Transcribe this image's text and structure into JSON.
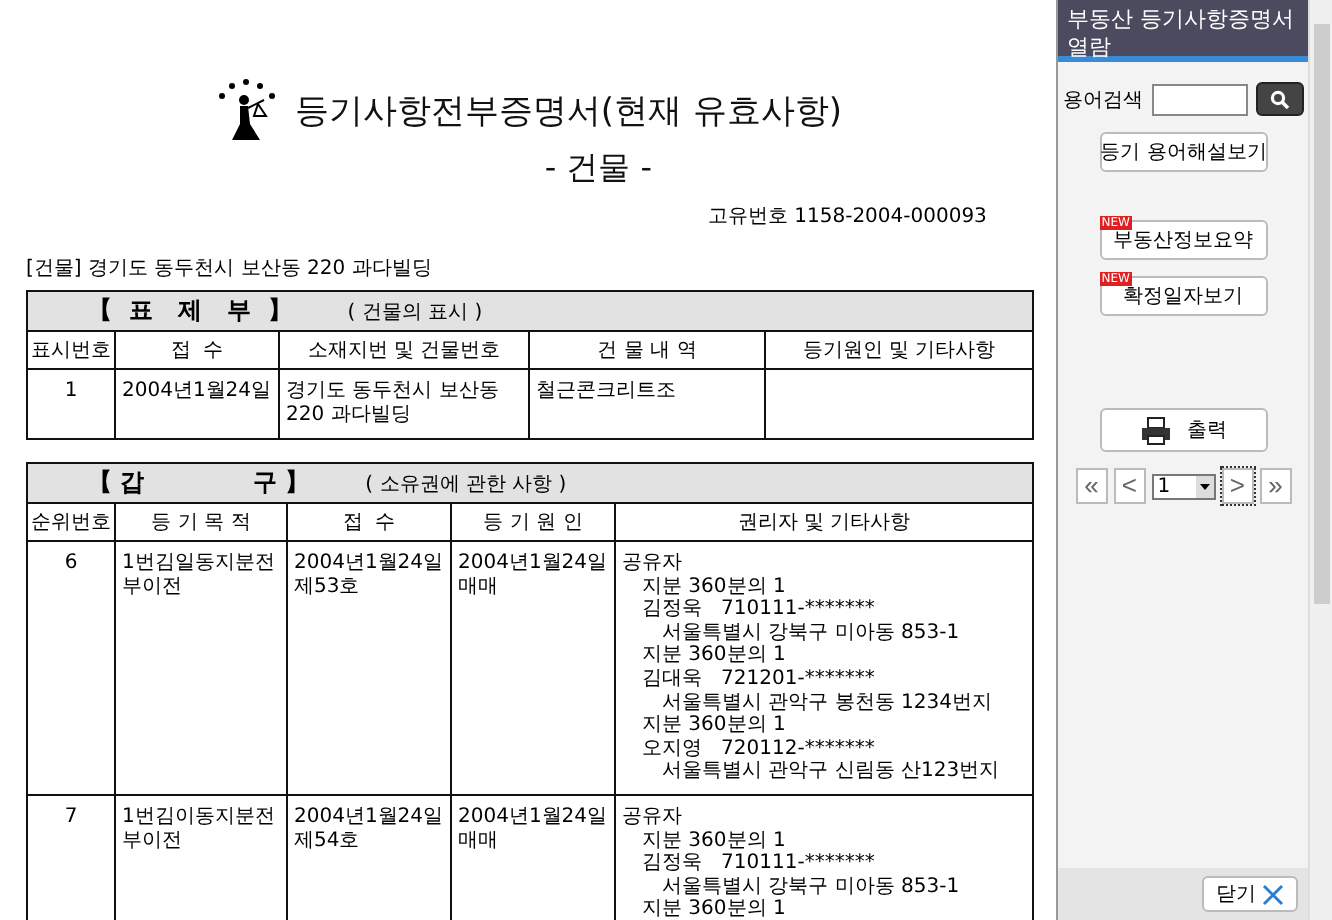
{
  "document": {
    "title": "등기사항전부증명서(현재 유효사항)",
    "subtitle": "- 건물 -",
    "unique_no": "고유번호 1158-2004-000093",
    "property": "[건물] 경기도 동두천시 보산동 220 과다빌딩"
  },
  "title_section": {
    "title": "【  표   제   부  】",
    "subtitle": "( 건물의 표시 )",
    "columns": [
      "표시번호",
      "접  수",
      "소재지번 및 건물번호",
      "건 물 내 역",
      "등기원인 및 기타사항"
    ],
    "rows": [
      {
        "no": "1",
        "receipt": "2004년1월24일",
        "location": "경기도 동두천시 보산동 220 과다빌딩",
        "building": "철근콘크리트조"
      }
    ]
  },
  "gap_section": {
    "title": "【 갑             구 】",
    "subtitle": "( 소유권에 관한 사항 )",
    "columns": [
      "순위번호",
      "등 기 목 적",
      "접  수",
      "등 기 원 인",
      "권리자 및 기타사항"
    ],
    "rows": [
      {
        "no": "6",
        "purpose": "1번김일동지분전부이전",
        "receipt_date": "2004년1월24일",
        "receipt_no": "제53호",
        "cause_date": "2004년1월24일",
        "cause": "매매",
        "rights": [
          {
            "text": "공유자",
            "children": [
              {
                "text": "지분 360분의 1"
              },
              {
                "text": "김정욱   710111-*******",
                "children": [
                  {
                    "text": "서울특별시 강북구 미아동 853-1"
                  }
                ]
              },
              {
                "text": "지분 360분의 1"
              },
              {
                "text": "김대욱   721201-*******",
                "children": [
                  {
                    "text": "서울특별시 관악구 봉천동 1234번지"
                  }
                ]
              },
              {
                "text": "지분 360분의 1"
              },
              {
                "text": "오지영   720112-*******",
                "children": [
                  {
                    "text": "서울특별시 관악구 신림동 산123번지"
                  }
                ]
              }
            ]
          }
        ]
      },
      {
        "no": "7",
        "purpose": "1번김이동지분전부이전",
        "receipt_date": "2004년1월24일",
        "receipt_no": "제54호",
        "cause_date": "2004년1월24일",
        "cause": "매매",
        "rights": [
          {
            "text": "공유자",
            "children": [
              {
                "text": "지분 360분의 1"
              },
              {
                "text": "김정욱   710111-*******",
                "children": [
                  {
                    "text": "서울특별시 강북구 미아동 853-1"
                  }
                ]
              },
              {
                "text": "지분 360분의 1"
              }
            ]
          }
        ]
      }
    ]
  },
  "sidebar": {
    "title": "부동산 등기사항증명서 열람",
    "search_label": "용어검색",
    "glossary_button": "등기 용어해설보기",
    "buttons": [
      {
        "label": "부동산정보요약",
        "badge": "NEW"
      },
      {
        "label": "확정일자보기",
        "badge": "NEW"
      }
    ],
    "print_button": "출력",
    "pager": {
      "first": "«",
      "prev": "<",
      "page": "1",
      "next": ">",
      "last": "»"
    },
    "close_button": "닫기"
  }
}
